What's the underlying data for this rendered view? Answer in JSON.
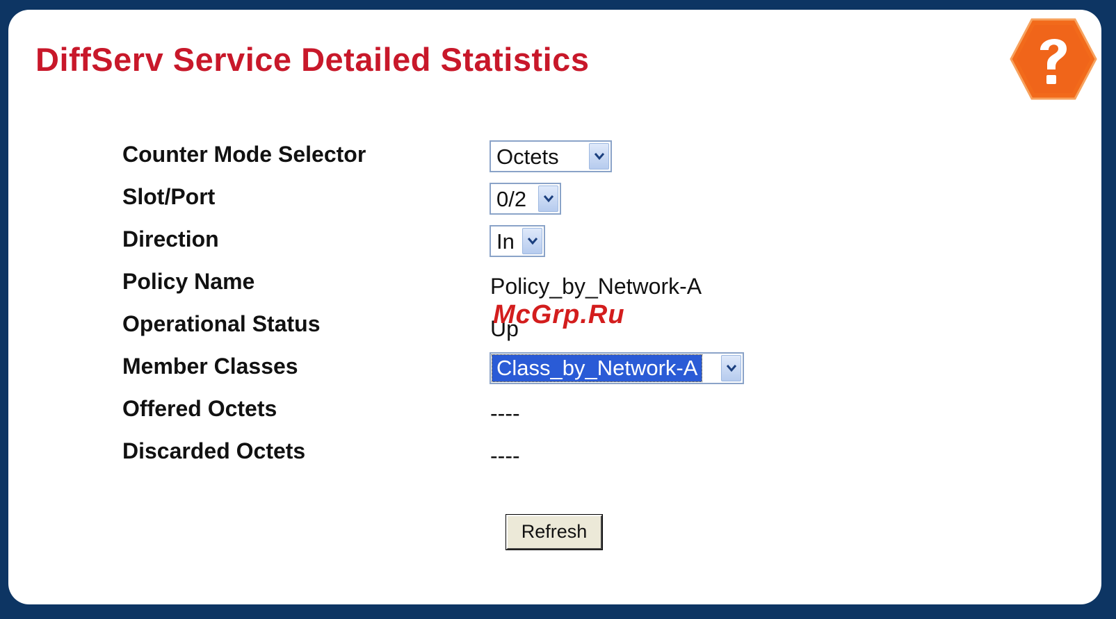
{
  "page": {
    "title": "DiffServ Service Detailed Statistics",
    "help_icon": "help-question-hexagon-icon"
  },
  "form": {
    "counter_mode": {
      "label": "Counter Mode Selector",
      "value": "Octets"
    },
    "slot_port": {
      "label": "Slot/Port",
      "value": "0/2"
    },
    "direction": {
      "label": "Direction",
      "value": "In"
    },
    "policy_name": {
      "label": "Policy Name",
      "value": "Policy_by_Network-A"
    },
    "operational_status": {
      "label": "Operational Status",
      "value": "Up"
    },
    "member_classes": {
      "label": "Member Classes",
      "value": "Class_by_Network-A"
    },
    "offered_octets": {
      "label": "Offered Octets",
      "value": "----"
    },
    "discarded_octets": {
      "label": "Discarded Octets",
      "value": "----"
    }
  },
  "actions": {
    "refresh_label": "Refresh"
  },
  "watermark": {
    "text": "McGrp.Ru"
  },
  "colors": {
    "frame": "#0d3563",
    "title": "#c8182a",
    "help_icon": "#f26a1b",
    "selection": "#2a5bd6"
  }
}
